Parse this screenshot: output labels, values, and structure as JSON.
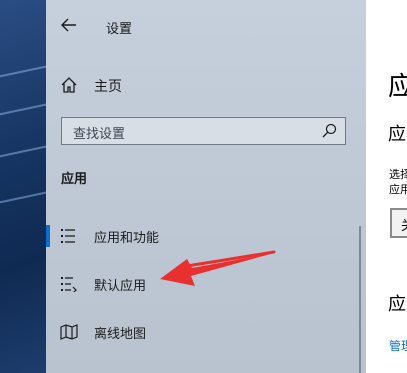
{
  "window": {
    "title": "设置"
  },
  "sidebar": {
    "home_label": "主页",
    "search_placeholder": "查找设置",
    "section_label": "应用",
    "items": [
      {
        "label": "应用和功能",
        "icon": "apps-features-icon",
        "selected": true
      },
      {
        "label": "默认应用",
        "icon": "default-apps-icon",
        "selected": false
      },
      {
        "label": "离线地图",
        "icon": "offline-maps-icon",
        "selected": false
      }
    ]
  },
  "content": {
    "heading": "应",
    "subheading": "应",
    "desc_line1": "选择",
    "desc_line2": "应用",
    "button_label": "关",
    "heading2": "应",
    "link_label": "管理"
  },
  "colors": {
    "accent": "#0a6fd1",
    "arrow": "#e8312f"
  }
}
